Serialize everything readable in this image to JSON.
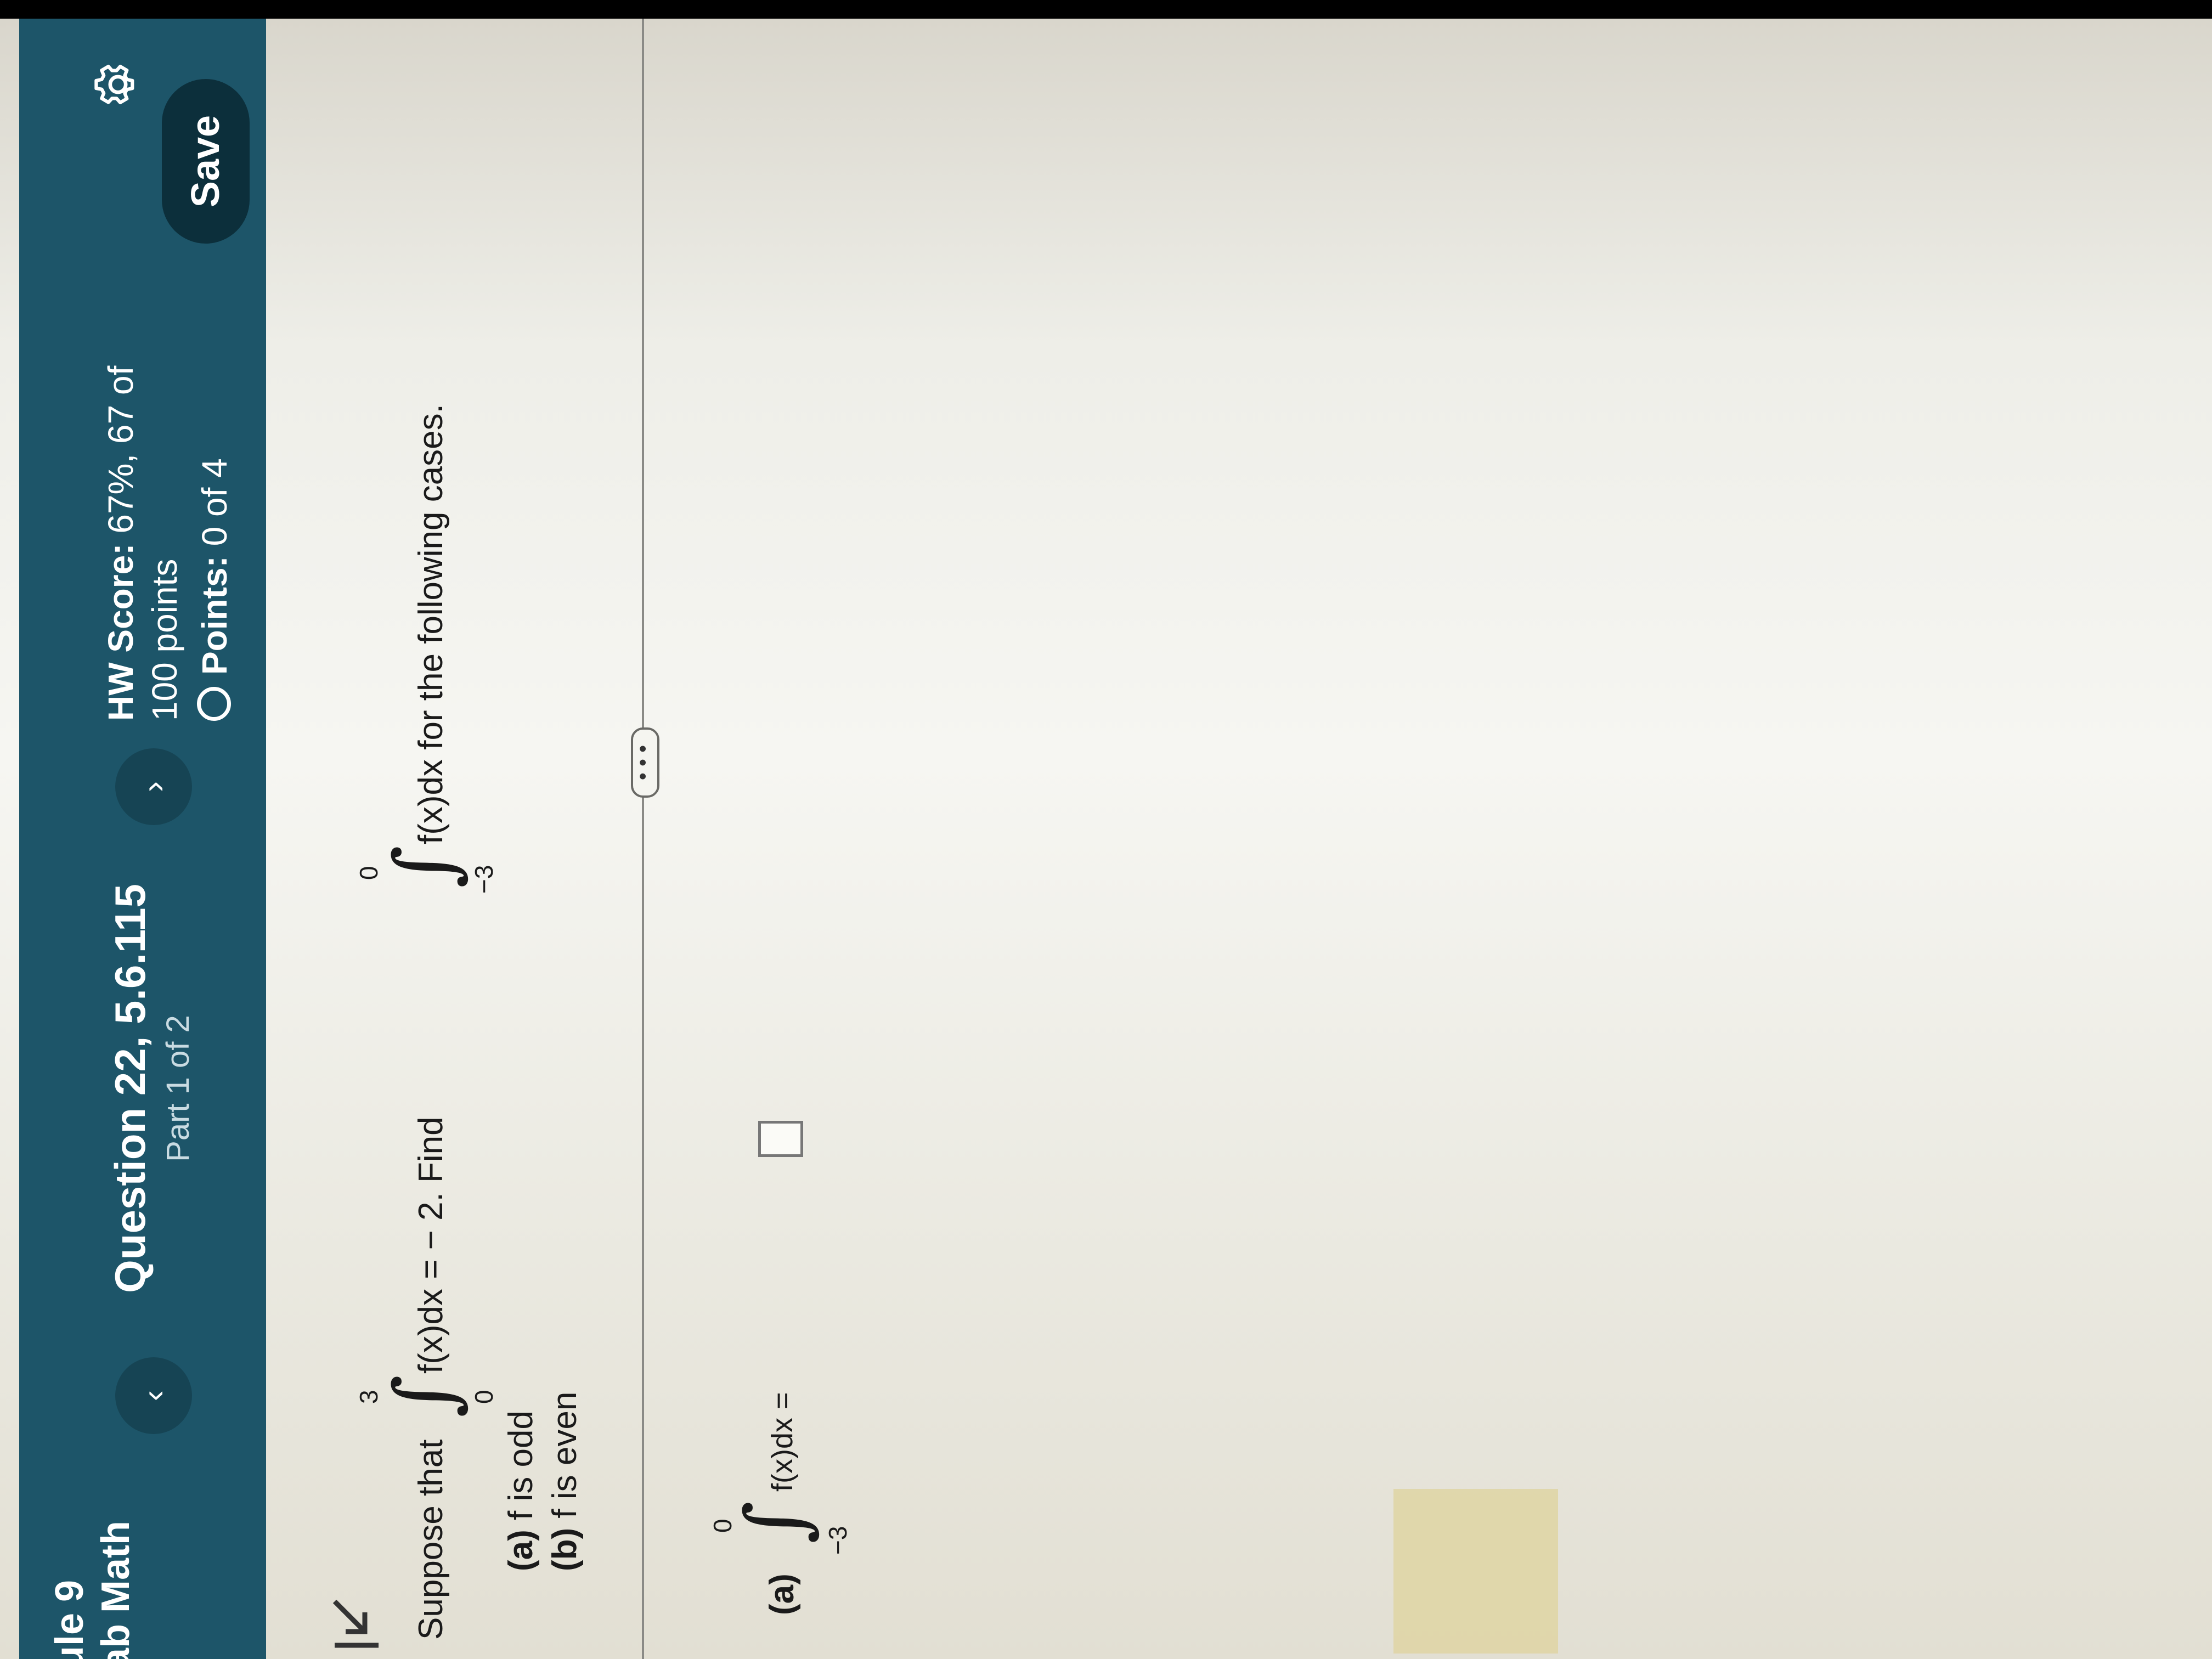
{
  "header": {
    "course_line1": "ule 9",
    "course_line2": "ab Math",
    "question_title": "Question 22, 5.6.115",
    "question_part": "Part 1 of 2",
    "hw_score_label": "HW Score:",
    "hw_score_value": "67%, 67 of",
    "hw_points_total": "100 points",
    "points_label": "Points:",
    "points_value": "0 of 4",
    "save_label": "Save",
    "prev_glyph": "‹",
    "next_glyph": "›",
    "settings_icon": "gear-icon"
  },
  "problem": {
    "prefix": "Suppose that",
    "integrand1": "f(x)dx = − 2. Find",
    "upper1": "3",
    "lower1": "0",
    "integrand2": "f(x)dx for the following cases.",
    "upper2": "0",
    "lower2": "−3",
    "cases": [
      {
        "label": "(a)",
        "text": "f is odd"
      },
      {
        "label": "(b)",
        "text": "f is even"
      }
    ]
  },
  "more_button": "• • •",
  "answer": {
    "label": "(a)",
    "upper": "0",
    "lower": "−3",
    "expression": "f(x)dx =",
    "value": ""
  },
  "colors": {
    "header": "#1d5569",
    "save_button": "#0c2f3b",
    "nav_button": "#164454"
  }
}
